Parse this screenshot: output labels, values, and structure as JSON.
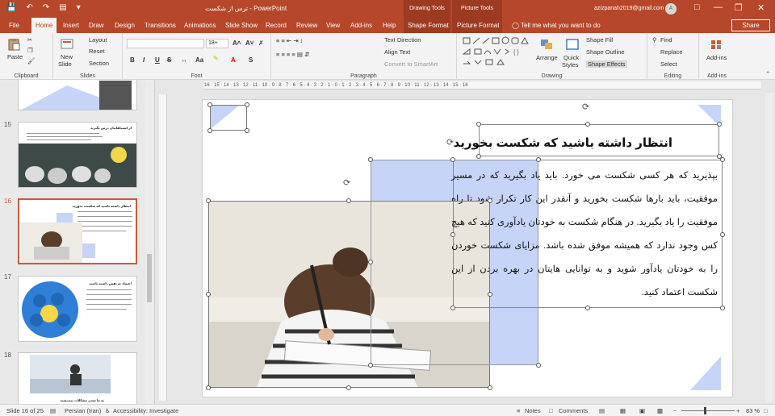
{
  "window": {
    "title": "ترس از شکست - PowerPoint",
    "context_drawing": "Drawing Tools",
    "context_picture": "Picture Tools",
    "user": "azizpanah2019@gmail.com",
    "avatar_letter": "A"
  },
  "tabs": [
    "File",
    "Home",
    "Insert",
    "Draw",
    "Design",
    "Transitions",
    "Animations",
    "Slide Show",
    "Record",
    "Review",
    "View",
    "Add-ins",
    "Help",
    "Shape Format",
    "Picture Format"
  ],
  "tell_me": "Tell me what you want to do",
  "share_label": "Share",
  "ribbon": {
    "clipboard": {
      "paste": "Paste",
      "label": "Clipboard"
    },
    "slides": {
      "new_slide": "New",
      "new_slide2": "Slide",
      "layout": "Layout",
      "reset": "Reset",
      "section": "Section",
      "label": "Slides"
    },
    "font": {
      "size": "18+",
      "bold": "B",
      "italic": "I",
      "underline": "U",
      "strike": "S",
      "label": "Font"
    },
    "paragraph": {
      "text_direction": "Text Direction",
      "align_text": "Align Text",
      "convert": "Convert to SmartArt",
      "label": "Paragraph"
    },
    "drawing": {
      "arrange": "Arrange",
      "quick": "Quick",
      "styles": "Styles",
      "shape_fill": "Shape Fill",
      "shape_outline": "Shape Outline",
      "shape_effects": "Shape Effects",
      "label": "Drawing"
    },
    "editing": {
      "find": "Find",
      "replace": "Replace",
      "select": "Select",
      "label": "Editing"
    },
    "addins": {
      "addins": "Add-ins",
      "label": "Add-ins"
    }
  },
  "thumbnails": [
    {
      "num": "15",
      "title": "از اشتباهاتتان درس بگیرید"
    },
    {
      "num": "16",
      "title": "انتظار داشته باشید که شکست بخورید"
    },
    {
      "num": "17",
      "title": "اعتماد به نفس داشته باشید"
    },
    {
      "num": "18",
      "title": "به ما شدن مشکلات بیندیشید"
    }
  ],
  "ruler": "16 · 15 · 14 · 13 · 12 · 11 · 10 · 9 · 8 · 7 · 6 · 5 · 4 · 3 · 2 · 1 · 0 · 1 · 2 · 3 · 4 · 5 · 6 · 7 · 8 · 9 · 10 · 11 · 12 · 13 · 14 · 15 · 16",
  "slide": {
    "title": "انتظار داشته باشید که شکست بخورید",
    "body": "بپذیرید که هر کسی شکست می خورد. باید یاد بگیرید که در مسیر موفقیت، باید بارها شکست بخورید و آنقدر این کار تکرار شود تا راه موفقیت را یاد بگیرید. در هنگام شکست به خودتان یادآوری کنید که هیچ کس وجود ندارد که همیشه موفق شده باشد. مزایای شکست خوردن را به خودتان یادآور شوید و به توانایی هایتان در بهره بردن از این شکست اعتماد کنید."
  },
  "status": {
    "slide": "Slide 16 of 25",
    "language": "Persian (Iran)",
    "accessibility": "Accessibility: Investigate",
    "notes": "Notes",
    "comments": "Comments",
    "zoom": "83 %"
  },
  "colors": {
    "accent": "#b7472a",
    "shape": "#c6d4f7"
  }
}
